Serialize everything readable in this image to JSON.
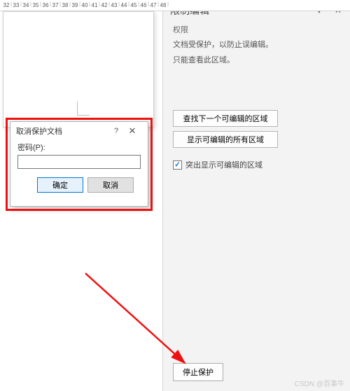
{
  "ruler": [
    "32",
    "33",
    "34",
    "35",
    "36",
    "37",
    "38",
    "39",
    "40",
    "41",
    "42",
    "43",
    "44",
    "45",
    "46",
    "47",
    "48"
  ],
  "dialog": {
    "title": "取消保护文档",
    "help": "?",
    "close": "✕",
    "password_label": "密码(P):",
    "password_value": "",
    "ok": "确定",
    "cancel": "取消"
  },
  "pane": {
    "title": "限制编辑",
    "dropdown": "▼",
    "close": "✕",
    "sub": "权限",
    "line1": "文档受保护，以防止误编辑。",
    "line2": "只能查看此区域。",
    "btn_find": "查找下一个可编辑的区域",
    "btn_show": "显示可编辑的所有区域",
    "chk_label": "突出显示可编辑的区域",
    "chk_checked": "✓",
    "stop": "停止保护"
  },
  "watermark": "CSDN @百事牛"
}
